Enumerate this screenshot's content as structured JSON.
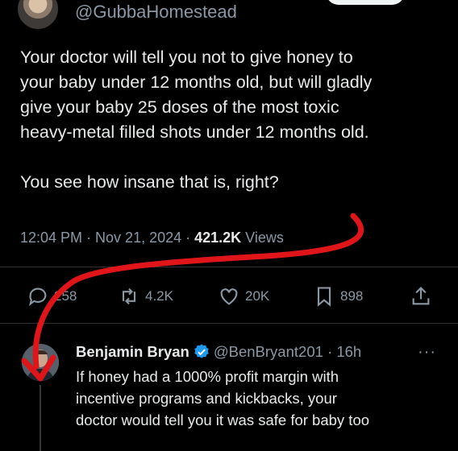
{
  "tweet": {
    "handle": "@GubbaHomestead",
    "text": "Your doctor will tell you not to give honey to\nyour baby under 12 months old, but will gladly\ngive your baby 25 doses of the most toxic\nheavy-metal filled shots under 12 months old.\n\nYou see how insane that is, right?",
    "time": "12:04 PM · Nov 21, 2024 · ",
    "views_count": "421.2K",
    "views_label": " Views"
  },
  "actions": {
    "replies": "258",
    "reposts": "4.2K",
    "likes": "20K",
    "bookmarks": "898"
  },
  "reply": {
    "name": "Benjamin Bryan",
    "handle_time": "@BenBryant201 · 16h",
    "more": "···",
    "text": "If honey had a 1000% profit margin with\nincentive programs and kickbacks, your\ndoctor would tell you it was safe for baby too"
  },
  "colors": {
    "background": "#000000",
    "text": "#e7e9ea",
    "muted": "#8b98a5",
    "verified": "#1d9bf0",
    "annotation": "#e0151a"
  },
  "icons": [
    "reply-icon",
    "repost-icon",
    "like-icon",
    "bookmark-icon",
    "share-icon",
    "verified-badge-icon",
    "more-icon"
  ]
}
